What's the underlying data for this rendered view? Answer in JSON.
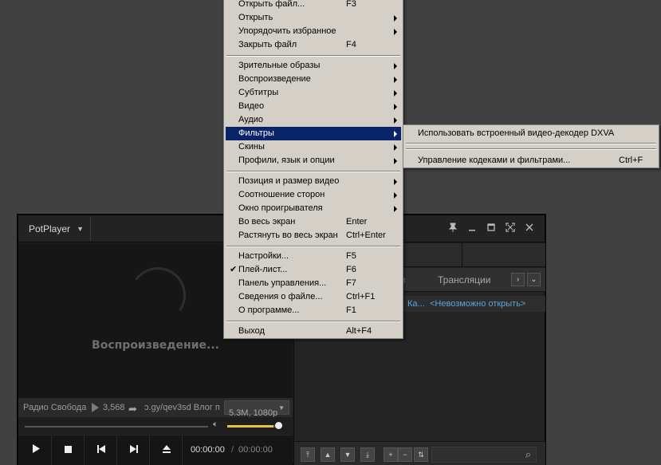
{
  "player": {
    "logo_label": "PotPlayer",
    "video": {
      "status": "Воспроизведение..."
    },
    "info": {
      "station": "Радио Свобода",
      "views": "3,568",
      "url": "ɔ.gy/qev3sd Влог п",
      "quality": "5.3M, 1080p"
    },
    "volume": {
      "level": 0.9
    },
    "time": {
      "current": "00:00:00",
      "separator": "/",
      "total": "00:00:00"
    },
    "panel": {
      "tab_residual": "и",
      "tab_broadcasts": "Трансляции",
      "playlist_name": "Ка...",
      "playlist_status": "<Невозможно открыть>"
    }
  },
  "menu": {
    "group1": [
      {
        "label": "Открыть файл...",
        "shortcut": "F3",
        "submenu": false
      },
      {
        "label": "Открыть",
        "shortcut": "",
        "submenu": true
      },
      {
        "label": "Упорядочить избранное",
        "shortcut": "",
        "submenu": true
      },
      {
        "label": "Закрыть файл",
        "shortcut": "F4",
        "submenu": false
      }
    ],
    "group2": [
      {
        "label": "Зрительные образы",
        "shortcut": "",
        "submenu": true
      },
      {
        "label": "Воспроизведение",
        "shortcut": "",
        "submenu": true
      },
      {
        "label": "Субтитры",
        "shortcut": "",
        "submenu": true
      },
      {
        "label": "Видео",
        "shortcut": "",
        "submenu": true
      },
      {
        "label": "Аудио",
        "shortcut": "",
        "submenu": true
      },
      {
        "label": "Фильтры",
        "shortcut": "",
        "submenu": true,
        "highlighted": true
      },
      {
        "label": "Скины",
        "shortcut": "",
        "submenu": true
      },
      {
        "label": "Профили, язык и опции",
        "shortcut": "",
        "submenu": true
      }
    ],
    "group3": [
      {
        "label": "Позиция и размер видео",
        "shortcut": "",
        "submenu": true
      },
      {
        "label": "Соотношение сторон",
        "shortcut": "",
        "submenu": true
      },
      {
        "label": "Окно проигрывателя",
        "shortcut": "",
        "submenu": true
      },
      {
        "label": "Во весь экран",
        "shortcut": "Enter",
        "submenu": false
      },
      {
        "label": "Растянуть во весь экран",
        "shortcut": "Ctrl+Enter",
        "submenu": false
      }
    ],
    "group4": [
      {
        "label": "Настройки...",
        "shortcut": "F5",
        "submenu": false
      },
      {
        "label": "Плей-лист...",
        "shortcut": "F6",
        "submenu": false,
        "checked": true
      },
      {
        "label": "Панель управления...",
        "shortcut": "F7",
        "submenu": false
      },
      {
        "label": "Сведения о файле...",
        "shortcut": "Ctrl+F1",
        "submenu": false
      },
      {
        "label": "О программе...",
        "shortcut": "F1",
        "submenu": false
      }
    ],
    "group5": [
      {
        "label": "Выход",
        "shortcut": "Alt+F4",
        "submenu": false
      }
    ]
  },
  "submenu": {
    "items": [
      {
        "label": "Использовать встроенный видео-декодер DXVA",
        "shortcut": ""
      },
      {
        "label": "Управление кодеками и фильтрами...",
        "shortcut": "Ctrl+F"
      }
    ]
  },
  "icons": {
    "play": "play-icon",
    "stop": "stop-icon",
    "prev": "previous-icon",
    "next": "next-icon",
    "eject": "eject-icon",
    "volume": "speaker-icon",
    "search": "search-icon",
    "pin": "pin-icon",
    "minimize": "minimize-icon",
    "maximize": "maximize-icon",
    "fullscreen": "fullscreen-icon",
    "close": "close-icon",
    "share": "share-icon"
  },
  "colors": {
    "menu_bg": "#d4d0c8",
    "menu_highlight": "#0a246a",
    "link": "#5ea4dc",
    "volume_fill": "#e9c53e"
  }
}
